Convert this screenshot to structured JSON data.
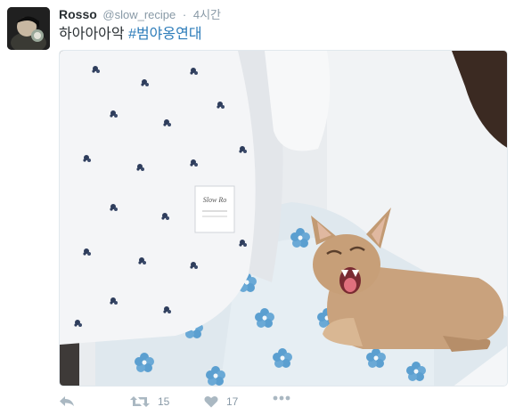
{
  "tweet": {
    "display_name": "Rosso",
    "handle": "@slow_recipe",
    "separator": "·",
    "time": "4시간",
    "text_plain": "하아아아악",
    "hashtag": "#범야옹연대"
  },
  "actions": {
    "reply_icon": "reply-icon",
    "retweet_icon": "retweet-icon",
    "retweet_count": "15",
    "like_icon": "heart-icon",
    "like_count": "17",
    "more_icon": "more-icon"
  },
  "photo": {
    "label_text": "Slow Ro",
    "accent_colors": {
      "kitten": "#c9a27d",
      "floral": "#5b9fd0",
      "hashtag": "#2b7bb9"
    }
  }
}
